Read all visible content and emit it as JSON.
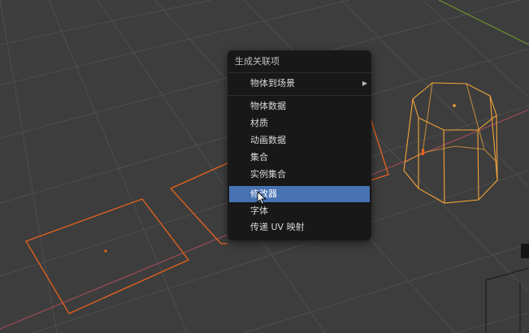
{
  "menu": {
    "title": "生成关联项",
    "items": [
      {
        "label": "物体到场景",
        "submenu": true
      },
      {
        "label": "物体数据"
      },
      {
        "label": "材质"
      },
      {
        "label": "动画数据"
      },
      {
        "label": "集合"
      },
      {
        "label": "实例集合"
      },
      {
        "label": "修改器",
        "highlighted": true
      },
      {
        "label": "字体"
      },
      {
        "label": "传递 UV 映射"
      }
    ],
    "submenu_arrow_icon": "triangle-right-icon"
  },
  "colors": {
    "background": "#3d3d3d",
    "grid": "#4e4e4e",
    "selected_outline": "#e8621c",
    "active_outline": "#f3a43a",
    "x_axis": "#9c4b57",
    "y_axis": "#6f8f2c",
    "menu_bg": "#181818",
    "highlight": "#4772b3"
  }
}
